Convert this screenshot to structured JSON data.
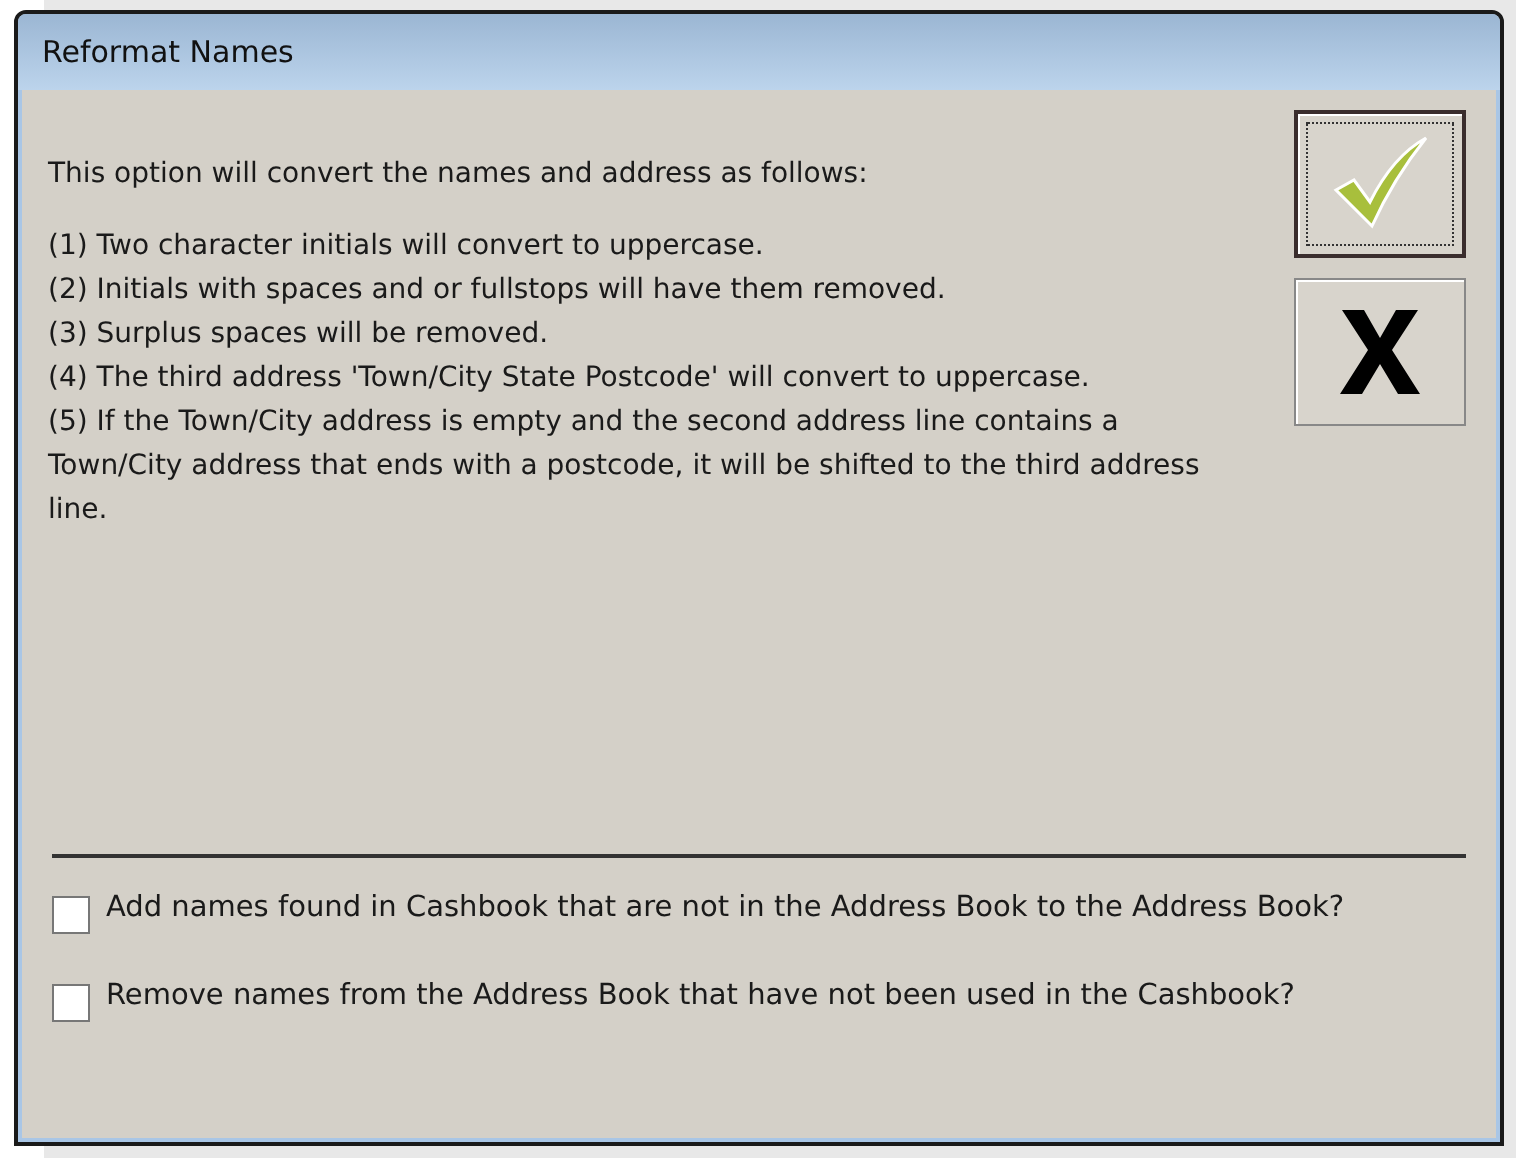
{
  "dialog": {
    "title": "Reformat Names",
    "intro": "This option will convert the names and address as follows:",
    "rules": [
      "(1) Two character initials will convert to uppercase.",
      "(2) Initials with spaces and or fullstops will have them removed.",
      "(3) Surplus spaces will be removed.",
      "(4) The third address 'Town/City State Postcode' will convert to uppercase.",
      "(5) If the Town/City address is empty and the second address line contains a Town/City address that ends with a postcode, it will be shifted to the third address line."
    ],
    "buttons": [
      {
        "kind": "ok",
        "focused": true
      },
      {
        "kind": "cancel",
        "focused": false
      }
    ],
    "options": [
      {
        "label": "Add names found in Cashbook that are not in the Address Book to the Address Book?",
        "checked": false
      },
      {
        "label": "Remove names from the Address Book that have not been used in the Cashbook?",
        "checked": false
      }
    ]
  }
}
